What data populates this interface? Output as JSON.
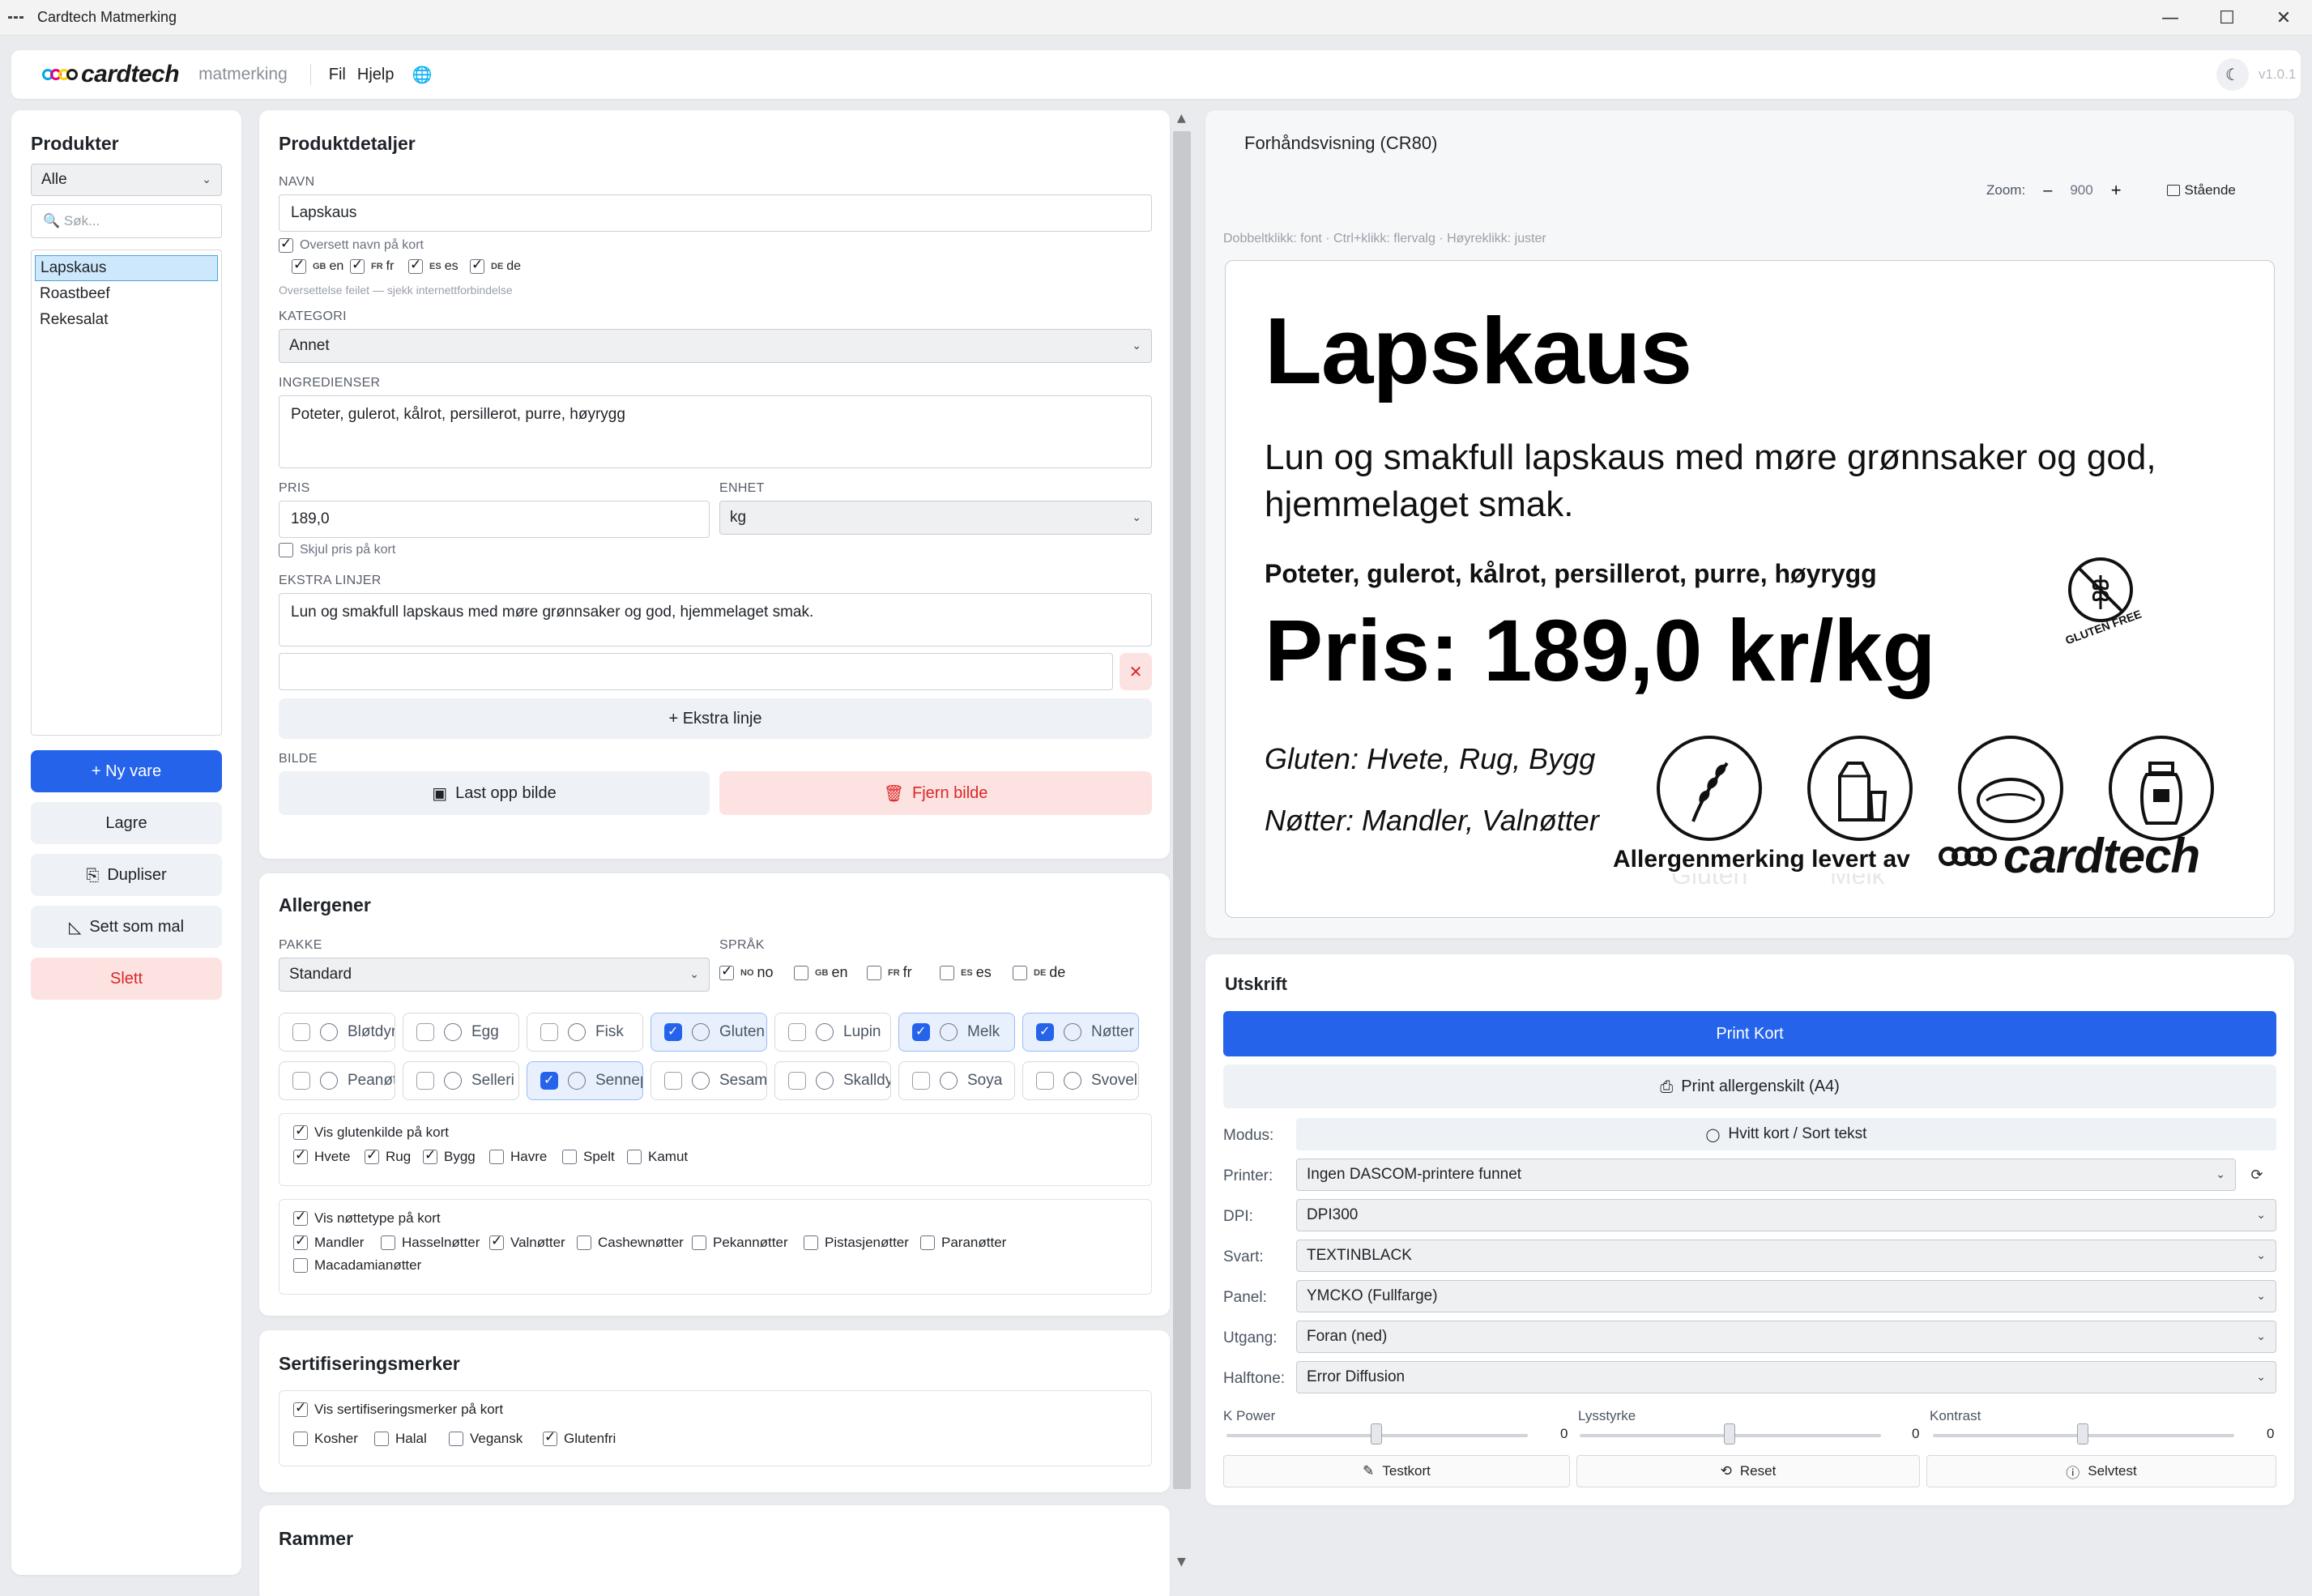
{
  "window": {
    "title": "Cardtech Matmerking"
  },
  "menubar": {
    "logo_text": "cardtech",
    "logo_sub": "matmerking",
    "menu_fil": "Fil",
    "menu_hjelp": "Hjelp",
    "version": "v1.0.1"
  },
  "products": {
    "title": "Produkter",
    "filter_value": "Alle",
    "search_placeholder": "🔍 Søk...",
    "items": [
      "Lapskaus",
      "Roastbeef",
      "Rekesalat"
    ],
    "new_btn": "+ Ny vare",
    "save_btn": "Lagre",
    "duplicate_btn": "Dupliser",
    "template_btn": "Sett som mal",
    "delete_btn": "Slett"
  },
  "details": {
    "title": "Produktdetaljer",
    "name_label": "NAVN",
    "name_value": "Lapskaus",
    "translate_label": "Oversett navn på kort",
    "translate_langs": [
      {
        "flag": "GB",
        "code": "en"
      },
      {
        "flag": "FR",
        "code": "fr"
      },
      {
        "flag": "ES",
        "code": "es"
      },
      {
        "flag": "DE",
        "code": "de"
      }
    ],
    "translate_error": "Oversettelse feilet — sjekk internettforbindelse",
    "category_label": "KATEGORI",
    "category_value": "Annet",
    "ingredients_label": "INGREDIENSER",
    "ingredients_value": "Poteter, gulerot, kålrot, persillerot, purre, høyrygg",
    "price_label": "PRIS",
    "price_value": "189,0",
    "unit_label": "ENHET",
    "unit_value": "kg",
    "hide_price_label": "Skjul pris på kort",
    "extra_label": "EKSTRA LINJER",
    "extra_value": "Lun og smakfull lapskaus med møre grønnsaker og god, hjemmelaget smak.",
    "add_extra_btn": "+ Ekstra linje",
    "image_label": "BILDE",
    "upload_btn": "Last opp bilde",
    "remove_img_btn": "Fjern bilde"
  },
  "allergens": {
    "title": "Allergener",
    "package_label": "PAKKE",
    "package_value": "Standard",
    "lang_label": "SPRÅK",
    "langs": [
      {
        "flag": "NO",
        "code": "no",
        "on": true
      },
      {
        "flag": "GB",
        "code": "en",
        "on": false
      },
      {
        "flag": "FR",
        "code": "fr",
        "on": false
      },
      {
        "flag": "ES",
        "code": "es",
        "on": false
      },
      {
        "flag": "DE",
        "code": "de",
        "on": false
      }
    ],
    "chips_row1": [
      {
        "label": "Bløtdyr",
        "on": false
      },
      {
        "label": "Egg",
        "on": false
      },
      {
        "label": "Fisk",
        "on": false
      },
      {
        "label": "Gluten",
        "on": true
      },
      {
        "label": "Lupin",
        "on": false
      },
      {
        "label": "Melk",
        "on": true
      },
      {
        "label": "Nøtter",
        "on": true
      }
    ],
    "chips_row2": [
      {
        "label": "Peanøtter",
        "on": false
      },
      {
        "label": "Selleri",
        "on": false
      },
      {
        "label": "Sennep",
        "on": true
      },
      {
        "label": "Sesam",
        "on": false
      },
      {
        "label": "Skalldyr",
        "on": false
      },
      {
        "label": "Soya",
        "on": false
      },
      {
        "label": "Svovel",
        "on": false
      }
    ],
    "gluten_show": "Vis glutenkilde på kort",
    "gluten_sources": [
      {
        "label": "Hvete",
        "on": true
      },
      {
        "label": "Rug",
        "on": true
      },
      {
        "label": "Bygg",
        "on": true
      },
      {
        "label": "Havre",
        "on": false
      },
      {
        "label": "Spelt",
        "on": false
      },
      {
        "label": "Kamut",
        "on": false
      }
    ],
    "nut_show": "Vis nøttetype på kort",
    "nut_types": [
      {
        "label": "Mandler",
        "on": true
      },
      {
        "label": "Hasselnøtter",
        "on": false
      },
      {
        "label": "Valnøtter",
        "on": true
      },
      {
        "label": "Cashewnøtter",
        "on": false
      },
      {
        "label": "Pekannøtter",
        "on": false
      },
      {
        "label": "Pistasjenøtter",
        "on": false
      },
      {
        "label": "Paranøtter",
        "on": false
      }
    ],
    "nut_extra": "Macadamianøtter"
  },
  "certs": {
    "title": "Sertifiseringsmerker",
    "show": "Vis sertifiseringsmerker på kort",
    "items": [
      {
        "label": "Kosher",
        "on": false
      },
      {
        "label": "Halal",
        "on": false
      },
      {
        "label": "Vegansk",
        "on": false
      },
      {
        "label": "Glutenfri",
        "on": true
      }
    ]
  },
  "frames": {
    "title": "Rammer"
  },
  "preview": {
    "title": "Forhåndsvisning (CR80)",
    "zoom_label": "Zoom:",
    "zoom_minus": "–",
    "zoom_value": "900",
    "zoom_plus": "+",
    "orientation": "Stående",
    "hint": "Dobbeltklikk: font · Ctrl+klikk: flervalg · Høyreklikk: juster",
    "card": {
      "title": "Lapskaus",
      "description": "Lun og smakfull lapskaus med møre grønnsaker og god, hjemmelaget smak.",
      "ingredients": "Poteter, gulerot, kålrot, persillerot, purre, høyrygg",
      "price": "Pris: 189,0 kr/kg",
      "gluten": "Gluten: Hvete, Rug, Bygg",
      "nuts": "Nøtter: Mandler, Valnøtter",
      "allergy_by": "Allergenmerking levert av",
      "logo": "cardtech",
      "gluten_free_badge": "GLUTEN FREE",
      "faded_gluten": "Gluten",
      "faded_melk": "Melk"
    }
  },
  "print": {
    "title": "Utskrift",
    "print_btn": "Print Kort",
    "print_a4_btn": "Print allergenskilt (A4)",
    "mode_label": "Modus:",
    "mode_value": "Hvitt kort / Sort tekst",
    "printer_label": "Printer:",
    "printer_value": "Ingen DASCOM-printere funnet",
    "dpi_label": "DPI:",
    "dpi_value": "DPI300",
    "black_label": "Svart:",
    "black_value": "TEXTINBLACK",
    "panel_label": "Panel:",
    "panel_value": "YMCKO (Fullfarge)",
    "output_label": "Utgang:",
    "output_value": "Foran (ned)",
    "halftone_label": "Halftone:",
    "halftone_value": "Error Diffusion",
    "kpower_label": "K Power",
    "kpower_value": "0",
    "brightness_label": "Lysstyrke",
    "brightness_value": "0",
    "contrast_label": "Kontrast",
    "contrast_value": "0",
    "test_btn": "Testkort",
    "reset_btn": "Reset",
    "selftest_btn": "Selvtest"
  },
  "colors": {
    "accent": "#2563eb",
    "danger": "#dc2626",
    "danger_bg": "#fde2e2",
    "logo_dots": [
      "#00a9e0",
      "#e6007e",
      "#ffd500",
      "#1a1a1a"
    ]
  }
}
